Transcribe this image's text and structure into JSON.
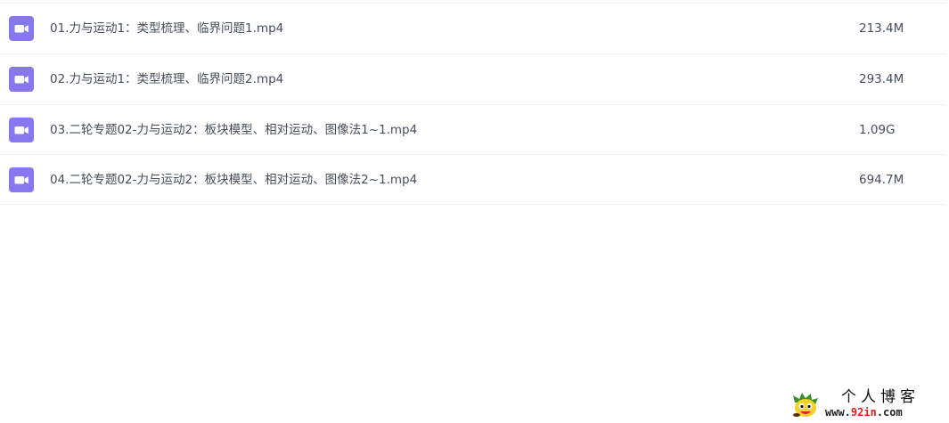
{
  "files": [
    {
      "name": "01.力与运动1：类型梳理、临界问题1.mp4",
      "size": "213.4M",
      "icon": "video-file-icon"
    },
    {
      "name": "02.力与运动1：类型梳理、临界问题2.mp4",
      "size": "293.4M",
      "icon": "video-file-icon"
    },
    {
      "name": "03.二轮专题02-力与运动2：板块模型、相对运动、图像法1~1.mp4",
      "size": "1.09G",
      "icon": "video-file-icon"
    },
    {
      "name": "04.二轮专题02-力与运动2：板块模型、相对运动、图像法2~1.mp4",
      "size": "694.7M",
      "icon": "video-file-icon"
    }
  ],
  "colors": {
    "icon_bg": "#8677ee",
    "text": "#454d5a",
    "divider": "#eef0f3"
  },
  "watermark": {
    "title": "个人博客",
    "url_prefix": "www.",
    "url_accent": "92in",
    "url_suffix": ".com"
  }
}
